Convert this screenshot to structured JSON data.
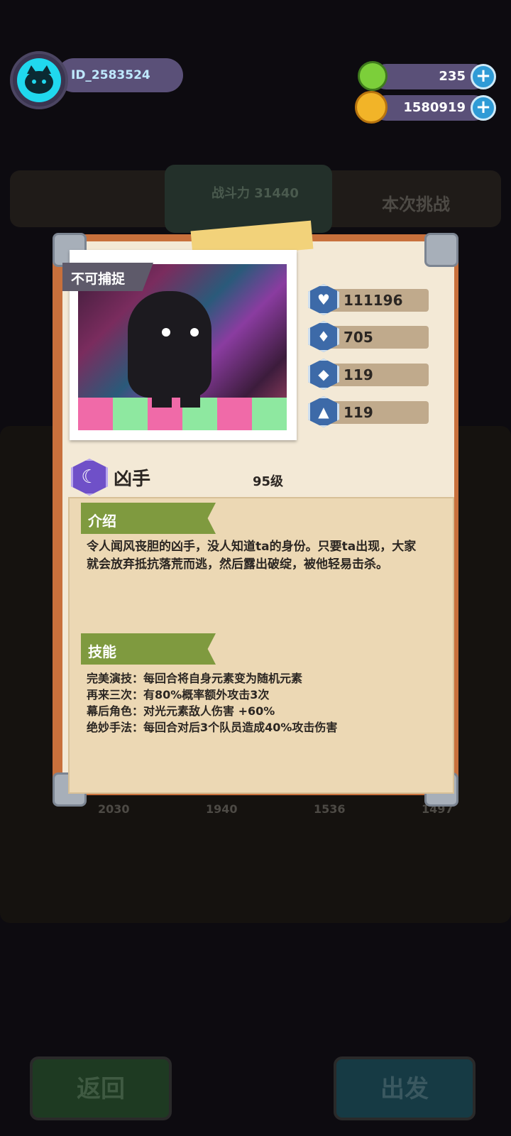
{
  "player": {
    "id": "ID_2583524"
  },
  "currency": [
    {
      "name": "gem",
      "amount": "235",
      "icon": "green-gem-icon",
      "color": "#7ccf3a"
    },
    {
      "name": "gold",
      "amount": "1580919",
      "icon": "gold-planet-icon",
      "color": "#f2b428"
    }
  ],
  "background": {
    "power_label": "战斗力 31440",
    "challenge_label": "本次挑战",
    "team_powers": [
      "2030",
      "1940",
      "1536",
      "1497"
    ],
    "buttons": {
      "back": "返回",
      "go": "出发"
    }
  },
  "card": {
    "tag": "不可捕捉",
    "name": "凶手",
    "level": "95级",
    "element_icon": "moon-element-icon",
    "stats": [
      {
        "icon": "heart-icon",
        "value": "111196"
      },
      {
        "icon": "sword-icon",
        "value": "705"
      },
      {
        "icon": "shield-icon",
        "value": "119"
      },
      {
        "icon": "speed-icon",
        "value": "119"
      }
    ],
    "intro_title": "介绍",
    "intro_text": "令人闻风丧胆的凶手，没人知道ta的身份。只要ta出现，大家就会放弃抵抗落荒而逃，然后露出破绽，被他轻易击杀。",
    "skills_title": "技能",
    "skills": [
      "完美演技：每回合将自身元素变为随机元素",
      "再来三次：有80%概率额外攻击3次",
      "幕后角色：对光元素敌人伤害 +60%",
      "绝妙手法：每回合对后3个队员造成40%攻击伤害"
    ]
  }
}
